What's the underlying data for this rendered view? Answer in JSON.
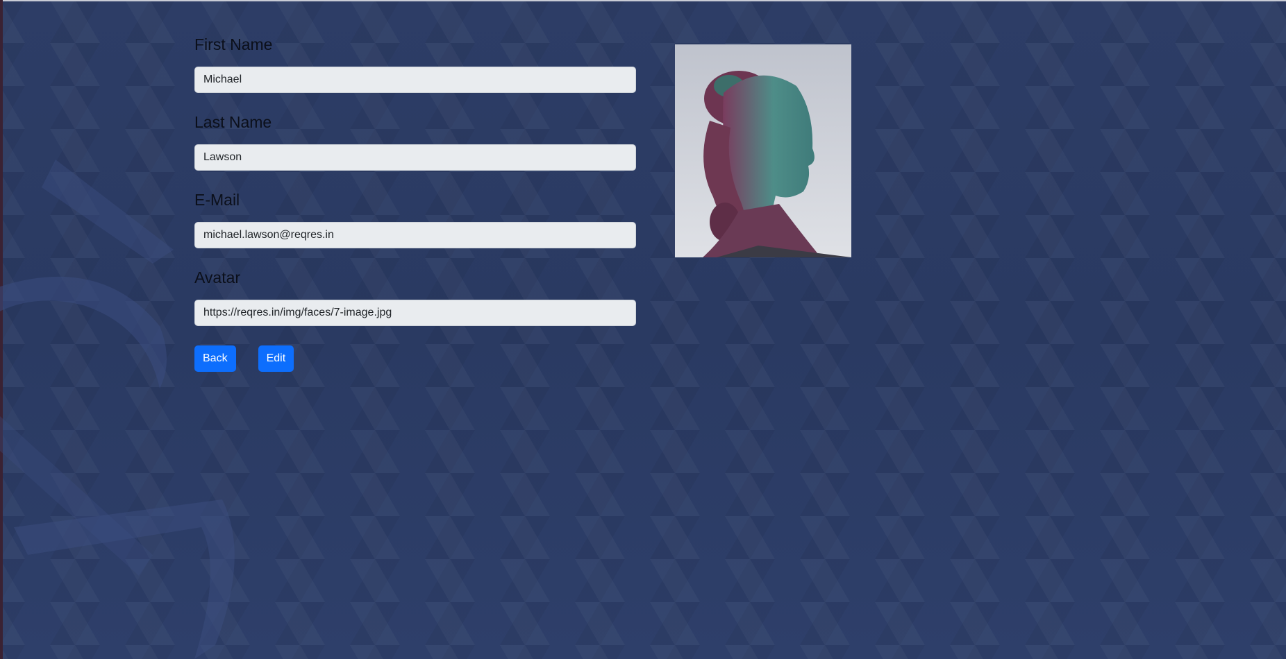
{
  "form": {
    "first_name_label": "First Name",
    "first_name_value": "Michael",
    "last_name_label": "Last Name",
    "last_name_value": "Lawson",
    "email_label": "E-Mail",
    "email_value": "michael.lawson@reqres.in",
    "avatar_label": "Avatar",
    "avatar_value": "https://reqres.in/img/faces/7-image.jpg"
  },
  "buttons": {
    "back_label": "Back",
    "edit_label": "Edit"
  },
  "colors": {
    "primary_button": "#0d6efd",
    "background": "#2b3a62",
    "input_background": "#e9ecef"
  },
  "icons": {
    "avatar_image": "portrait-photo"
  }
}
